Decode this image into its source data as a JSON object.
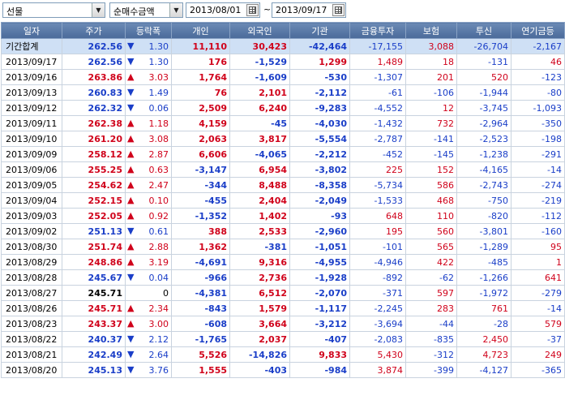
{
  "toolbar": {
    "market_select": "선물",
    "type_select": "순매수금액",
    "date_from": "2013/08/01",
    "date_sep": "~",
    "date_to": "2013/09/17"
  },
  "colors": {
    "up": "#d0021b",
    "down": "#1a3ec8",
    "header_bg": "#5878a8",
    "summary_bg": "#cfe0f5"
  },
  "columns": [
    "일자",
    "주가",
    "등락폭",
    "개인",
    "외국인",
    "기관",
    "금융투자",
    "보험",
    "투신",
    "연기금등"
  ],
  "summary": {
    "date": "기간합계",
    "price": "262.56",
    "dir": "down",
    "chg": "1.30",
    "indiv": "11,110",
    "foreign": "30,423",
    "inst": "-42,464",
    "fin": "-17,155",
    "ins": "3,088",
    "trust": "-26,704",
    "pension": "-2,167"
  },
  "rows": [
    {
      "date": "2013/09/17",
      "price": "262.56",
      "dir": "down",
      "chg": "1.30",
      "indiv": "176",
      "foreign": "-1,529",
      "inst": "1,299",
      "fin": "1,489",
      "ins": "18",
      "trust": "-131",
      "pension": "46"
    },
    {
      "date": "2013/09/16",
      "price": "263.86",
      "dir": "up",
      "chg": "3.03",
      "indiv": "1,764",
      "foreign": "-1,609",
      "inst": "-530",
      "fin": "-1,307",
      "ins": "201",
      "trust": "520",
      "pension": "-123"
    },
    {
      "date": "2013/09/13",
      "price": "260.83",
      "dir": "down",
      "chg": "1.49",
      "indiv": "76",
      "foreign": "2,101",
      "inst": "-2,112",
      "fin": "-61",
      "ins": "-106",
      "trust": "-1,944",
      "pension": "-80"
    },
    {
      "date": "2013/09/12",
      "price": "262.32",
      "dir": "down",
      "chg": "0.06",
      "indiv": "2,509",
      "foreign": "6,240",
      "inst": "-9,283",
      "fin": "-4,552",
      "ins": "12",
      "trust": "-3,745",
      "pension": "-1,093"
    },
    {
      "date": "2013/09/11",
      "price": "262.38",
      "dir": "up",
      "chg": "1.18",
      "indiv": "4,159",
      "foreign": "-45",
      "inst": "-4,030",
      "fin": "-1,432",
      "ins": "732",
      "trust": "-2,964",
      "pension": "-350"
    },
    {
      "date": "2013/09/10",
      "price": "261.20",
      "dir": "up",
      "chg": "3.08",
      "indiv": "2,063",
      "foreign": "3,817",
      "inst": "-5,554",
      "fin": "-2,787",
      "ins": "-141",
      "trust": "-2,523",
      "pension": "-198"
    },
    {
      "date": "2013/09/09",
      "price": "258.12",
      "dir": "up",
      "chg": "2.87",
      "indiv": "6,606",
      "foreign": "-4,065",
      "inst": "-2,212",
      "fin": "-452",
      "ins": "-145",
      "trust": "-1,238",
      "pension": "-291"
    },
    {
      "date": "2013/09/06",
      "price": "255.25",
      "dir": "up",
      "chg": "0.63",
      "indiv": "-3,147",
      "foreign": "6,954",
      "inst": "-3,802",
      "fin": "225",
      "ins": "152",
      "trust": "-4,165",
      "pension": "-14"
    },
    {
      "date": "2013/09/05",
      "price": "254.62",
      "dir": "up",
      "chg": "2.47",
      "indiv": "-344",
      "foreign": "8,488",
      "inst": "-8,358",
      "fin": "-5,734",
      "ins": "586",
      "trust": "-2,743",
      "pension": "-274"
    },
    {
      "date": "2013/09/04",
      "price": "252.15",
      "dir": "up",
      "chg": "0.10",
      "indiv": "-455",
      "foreign": "2,404",
      "inst": "-2,049",
      "fin": "-1,533",
      "ins": "468",
      "trust": "-750",
      "pension": "-219"
    },
    {
      "date": "2013/09/03",
      "price": "252.05",
      "dir": "up",
      "chg": "0.92",
      "indiv": "-1,352",
      "foreign": "1,402",
      "inst": "-93",
      "fin": "648",
      "ins": "110",
      "trust": "-820",
      "pension": "-112"
    },
    {
      "date": "2013/09/02",
      "price": "251.13",
      "dir": "down",
      "chg": "0.61",
      "indiv": "388",
      "foreign": "2,533",
      "inst": "-2,960",
      "fin": "195",
      "ins": "560",
      "trust": "-3,801",
      "pension": "-160"
    },
    {
      "date": "2013/08/30",
      "price": "251.74",
      "dir": "up",
      "chg": "2.88",
      "indiv": "1,362",
      "foreign": "-381",
      "inst": "-1,051",
      "fin": "-101",
      "ins": "565",
      "trust": "-1,289",
      "pension": "95"
    },
    {
      "date": "2013/08/29",
      "price": "248.86",
      "dir": "up",
      "chg": "3.19",
      "indiv": "-4,691",
      "foreign": "9,316",
      "inst": "-4,955",
      "fin": "-4,946",
      "ins": "422",
      "trust": "-485",
      "pension": "1"
    },
    {
      "date": "2013/08/28",
      "price": "245.67",
      "dir": "down",
      "chg": "0.04",
      "indiv": "-966",
      "foreign": "2,736",
      "inst": "-1,928",
      "fin": "-892",
      "ins": "-62",
      "trust": "-1,266",
      "pension": "641"
    },
    {
      "date": "2013/08/27",
      "price": "245.71",
      "dir": "flat",
      "chg": "0",
      "indiv": "-4,381",
      "foreign": "6,512",
      "inst": "-2,070",
      "fin": "-371",
      "ins": "597",
      "trust": "-1,972",
      "pension": "-279"
    },
    {
      "date": "2013/08/26",
      "price": "245.71",
      "dir": "up",
      "chg": "2.34",
      "indiv": "-843",
      "foreign": "1,579",
      "inst": "-1,117",
      "fin": "-2,245",
      "ins": "283",
      "trust": "761",
      "pension": "-14"
    },
    {
      "date": "2013/08/23",
      "price": "243.37",
      "dir": "up",
      "chg": "3.00",
      "indiv": "-608",
      "foreign": "3,664",
      "inst": "-3,212",
      "fin": "-3,694",
      "ins": "-44",
      "trust": "-28",
      "pension": "579"
    },
    {
      "date": "2013/08/22",
      "price": "240.37",
      "dir": "down",
      "chg": "2.12",
      "indiv": "-1,765",
      "foreign": "2,037",
      "inst": "-407",
      "fin": "-2,083",
      "ins": "-835",
      "trust": "2,450",
      "pension": "-37"
    },
    {
      "date": "2013/08/21",
      "price": "242.49",
      "dir": "down",
      "chg": "2.64",
      "indiv": "5,526",
      "foreign": "-14,826",
      "inst": "9,833",
      "fin": "5,430",
      "ins": "-312",
      "trust": "4,723",
      "pension": "249"
    },
    {
      "date": "2013/08/20",
      "price": "245.13",
      "dir": "down",
      "chg": "3.76",
      "indiv": "1,555",
      "foreign": "-403",
      "inst": "-984",
      "fin": "3,874",
      "ins": "-399",
      "trust": "-4,127",
      "pension": "-365"
    }
  ]
}
